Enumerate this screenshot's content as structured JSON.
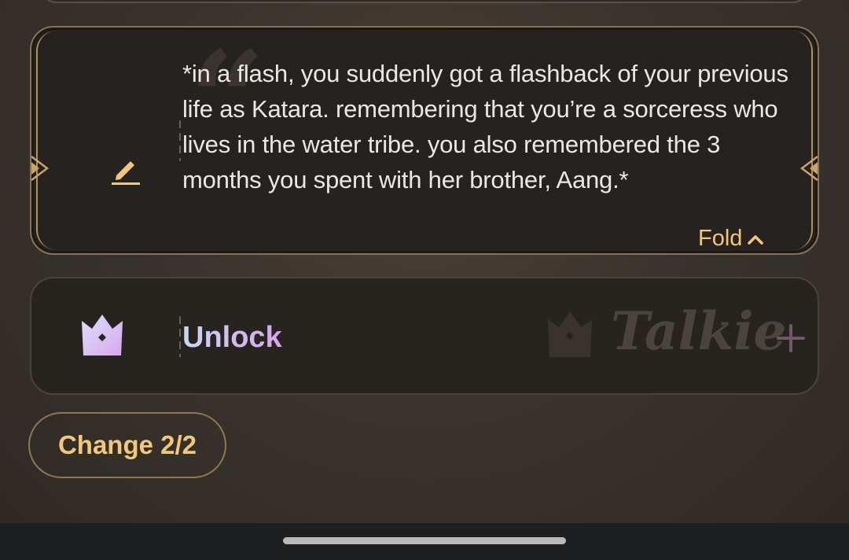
{
  "prompt": {
    "text": "*in a flash, you suddenly got a flashback of your previous life as Katara. remembering that you’re a sorceress who lives in the water tribe. you also remembered the 3 months you spent with her brother, Aang.*",
    "fold_label": "Fold",
    "icons": [
      "pencil-icon",
      "chevron-up-icon",
      "quote-icon"
    ]
  },
  "unlock": {
    "label": "Unlock",
    "watermark": "Talkie",
    "icons": [
      "crown-icon",
      "plus-icon"
    ]
  },
  "change_button": {
    "label": "Change 2/2"
  },
  "colors": {
    "accent_gold": "#f3c77a",
    "card_bg": "#26221f",
    "gradient_start": "#c9d8f4",
    "gradient_end": "#d7a4ea"
  }
}
